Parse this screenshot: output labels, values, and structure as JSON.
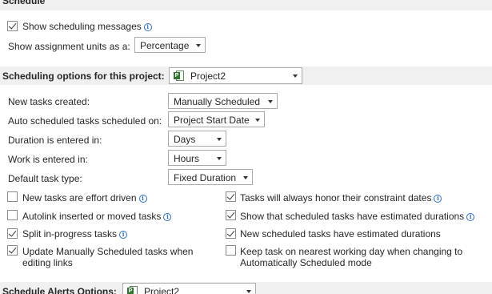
{
  "schedule": {
    "header": "Schedule",
    "show_messages": {
      "label": "Show scheduling messages",
      "checked": true
    },
    "assignment_units": {
      "label": "Show assignment units as a:",
      "value": "Percentage"
    }
  },
  "options": {
    "header": "Scheduling options for this project:",
    "project": "Project2",
    "new_tasks": {
      "label": "New tasks created:",
      "value": "Manually Scheduled"
    },
    "auto_tasks": {
      "label": "Auto scheduled tasks scheduled on:",
      "value": "Project Start Date"
    },
    "duration": {
      "label": "Duration is entered in:",
      "value": "Days"
    },
    "work": {
      "label": "Work is entered in:",
      "value": "Hours"
    },
    "task_type": {
      "label": "Default task type:",
      "value": "Fixed Duration"
    },
    "checkboxes_left": [
      {
        "label": "New tasks are effort driven",
        "checked": false,
        "info": true
      },
      {
        "label": "Autolink inserted or moved tasks",
        "checked": false,
        "info": true
      },
      {
        "label": "Split in-progress tasks",
        "checked": true,
        "info": true
      },
      {
        "label_line1": "Update Manually Scheduled tasks when",
        "label_line2": "editing links",
        "checked": true,
        "info": false
      }
    ],
    "checkboxes_right": [
      {
        "label": "Tasks will always honor their constraint dates",
        "checked": true,
        "info": true
      },
      {
        "label": "Show that scheduled tasks have estimated durations",
        "checked": true,
        "info": true
      },
      {
        "label": "New scheduled tasks have estimated durations",
        "checked": true,
        "info": false
      },
      {
        "label_line1": "Keep task on nearest working day when changing to",
        "label_line2": "Automatically Scheduled mode",
        "checked": false,
        "info": false
      }
    ]
  },
  "alerts": {
    "header": "Schedule Alerts Options:",
    "project": "Project2"
  },
  "icons": {
    "project_file": "project-file-icon",
    "info": "info-icon",
    "dropdown": "chevron-down-icon"
  },
  "colors": {
    "section_bg": "#f0f0f0",
    "info_blue": "#2f6ebf",
    "project_green": "#31752f"
  }
}
